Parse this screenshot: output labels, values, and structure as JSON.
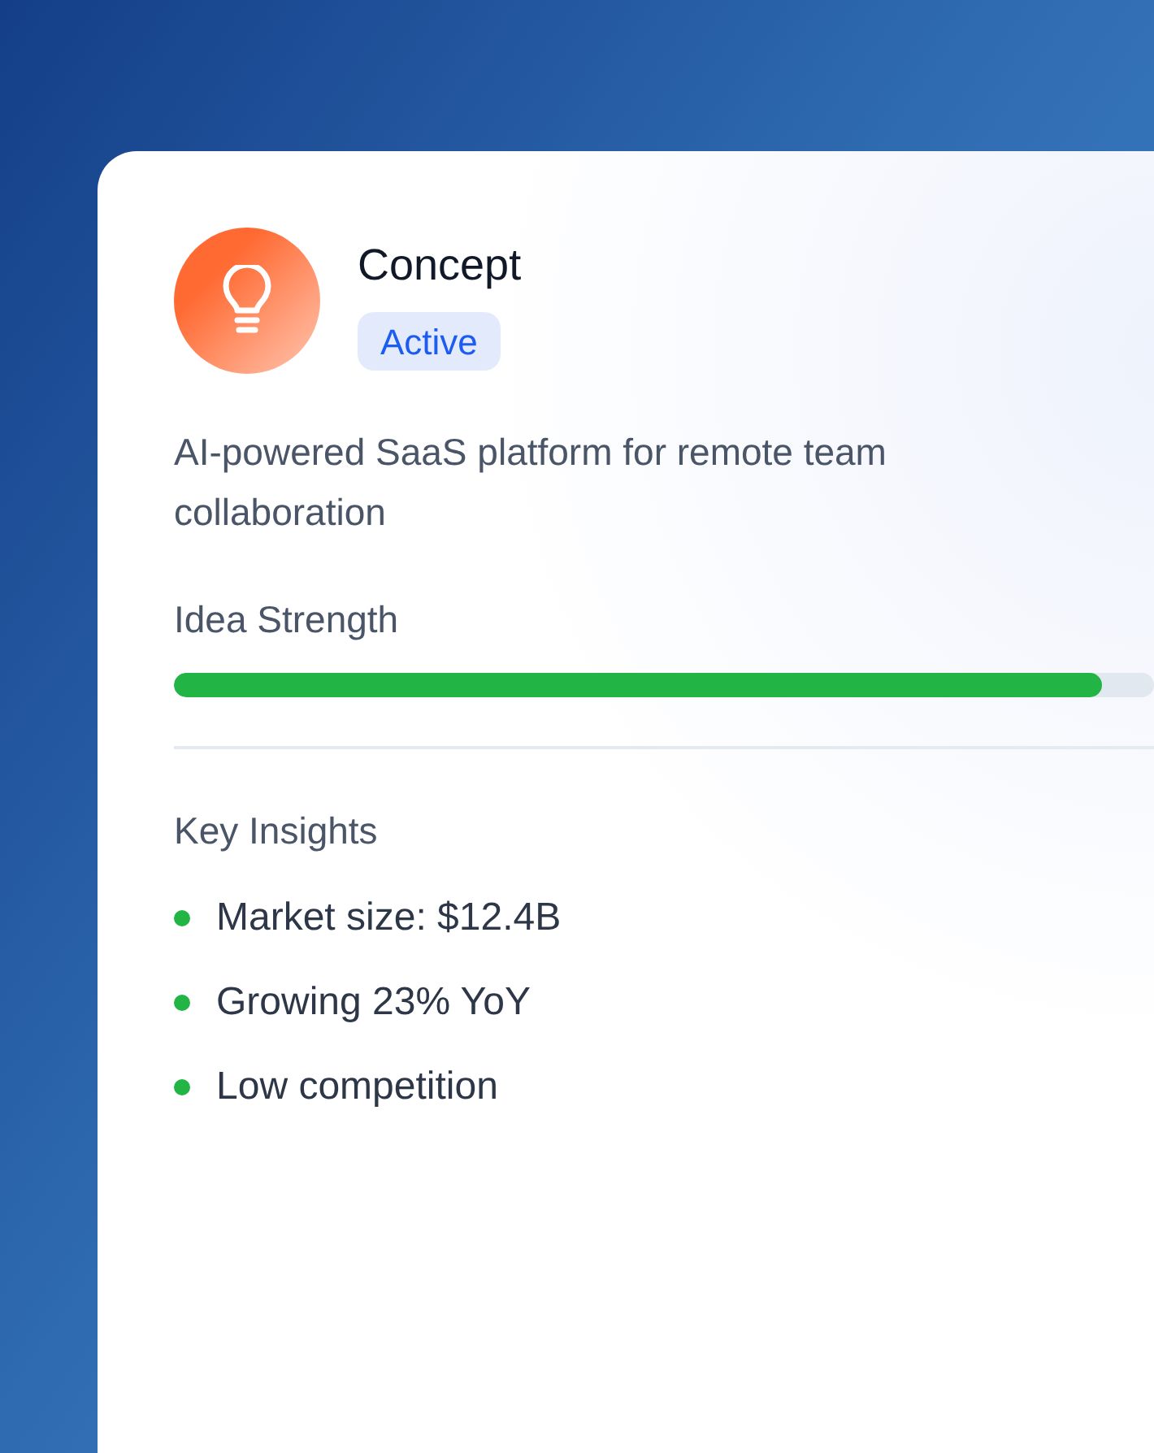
{
  "card": {
    "title": "Concept",
    "status": "Active",
    "description": "AI-powered SaaS platform for remote team collaboration",
    "strength": {
      "label": "Idea Strength",
      "level": 0.947
    },
    "insights_title": "Key Insights",
    "insights": [
      {
        "text": "Market size: $12.4B",
        "color": "#22b545"
      },
      {
        "text": "Growing 23% YoY",
        "color": "#22b545"
      },
      {
        "text": "Low competition",
        "color": "#22b545"
      }
    ]
  }
}
